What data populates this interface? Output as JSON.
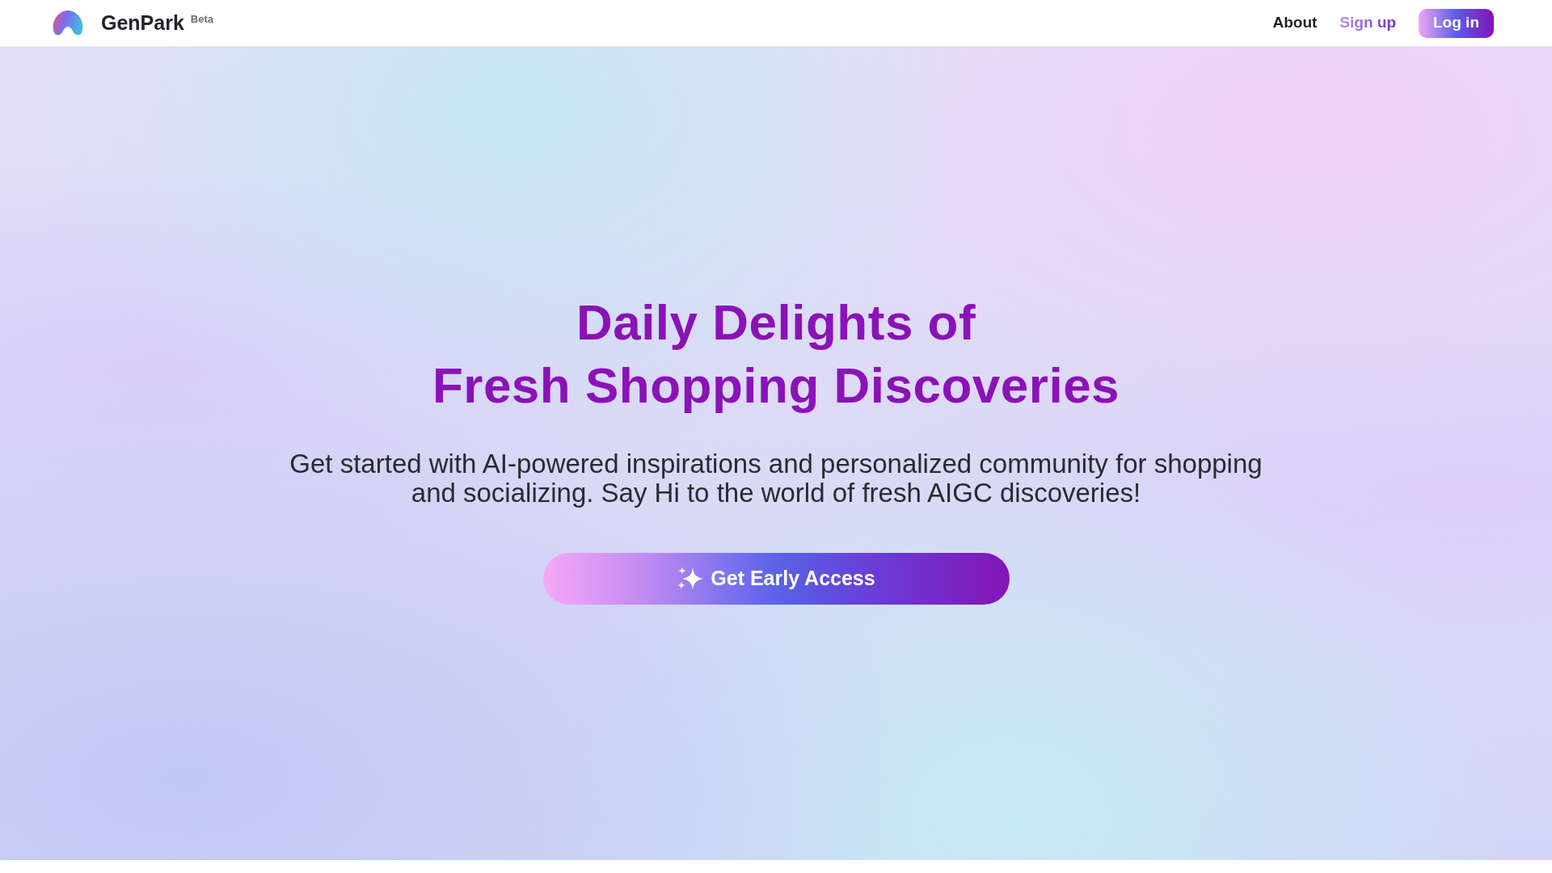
{
  "header": {
    "logo_text": "GenPark",
    "badge": "Beta",
    "nav": [
      {
        "label": "About",
        "kind": "link"
      },
      {
        "label": "Sign up",
        "kind": "accent"
      },
      {
        "label": "Log in",
        "kind": "button"
      }
    ]
  },
  "hero": {
    "headline": [
      "Daily Delights of",
      "Fresh Shopping Discoveries"
    ],
    "subtitle": "Get started with AI-powered inspirations and personalized community for shopping and socializing. Say Hi to the world of fresh AIGC discoveries!",
    "cta": "Get Early Access"
  }
}
